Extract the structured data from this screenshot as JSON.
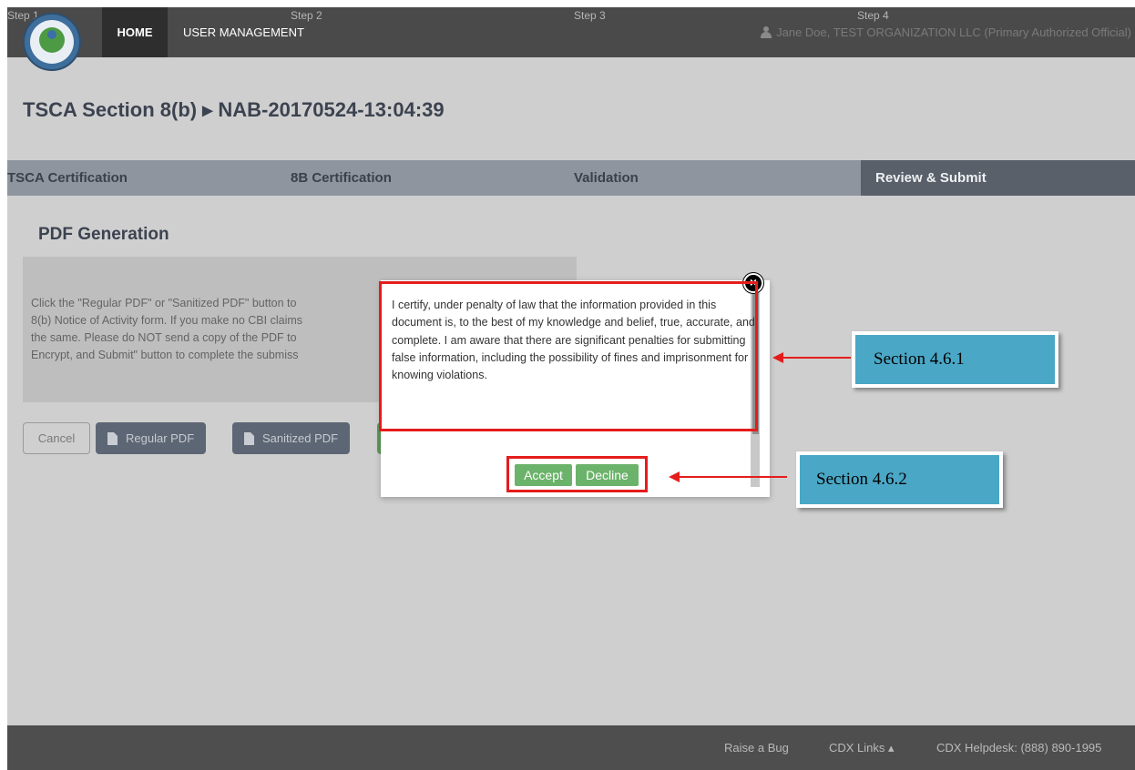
{
  "header": {
    "logo_alt": "EPA seal",
    "nav": [
      {
        "label": "HOME",
        "active": true
      },
      {
        "label": "USER MANAGEMENT",
        "active": false
      }
    ],
    "user": "Jane Doe, TEST ORGANIZATION LLC (Primary Authorized Official)"
  },
  "page": {
    "title": "TSCA Section 8(b) ▸ NAB-20170524-13:04:39"
  },
  "steps": [
    {
      "num": "Step 1",
      "label": "TSCA Certification",
      "active": false
    },
    {
      "num": "Step 2",
      "label": "8B Certification",
      "active": false
    },
    {
      "num": "Step 3",
      "label": "Validation",
      "active": false
    },
    {
      "num": "Step 4",
      "label": "Review & Submit",
      "active": true
    }
  ],
  "pdf_section": {
    "title": "PDF Generation",
    "text_lines": [
      "Click the \"Regular PDF\" or \"Sanitized PDF\" button to",
      "8(b) Notice of Activity form. If you make no CBI claims",
      "the same. Please do NOT send a copy of the PDF to",
      "Encrypt, and Submit\" button to complete the submiss"
    ]
  },
  "buttons": {
    "cancel": "Cancel",
    "regular_pdf": "Regular PDF",
    "sanitized_pdf": "Sanitized PDF"
  },
  "modal": {
    "close_glyph": "×",
    "text": "I certify, under penalty of law that the information provided in this document is, to the best of my knowledge and belief, true, accurate, and complete. I am aware that there are significant penalties for submitting false information, including the possibility of fines and imprisonment for knowing violations.",
    "accept": "Accept",
    "decline": "Decline"
  },
  "annotations": [
    {
      "label": "Section 4.6.1"
    },
    {
      "label": "Section 4.6.2"
    }
  ],
  "footer": {
    "raise_bug": "Raise a Bug",
    "cdx_links": "CDX Links ▴",
    "helpdesk": "CDX Helpdesk: (888) 890-1995"
  },
  "colors": {
    "highlight": "#e51c1c",
    "callout_bg": "#4aa7c6",
    "accept_bg": "#6bb36a"
  }
}
